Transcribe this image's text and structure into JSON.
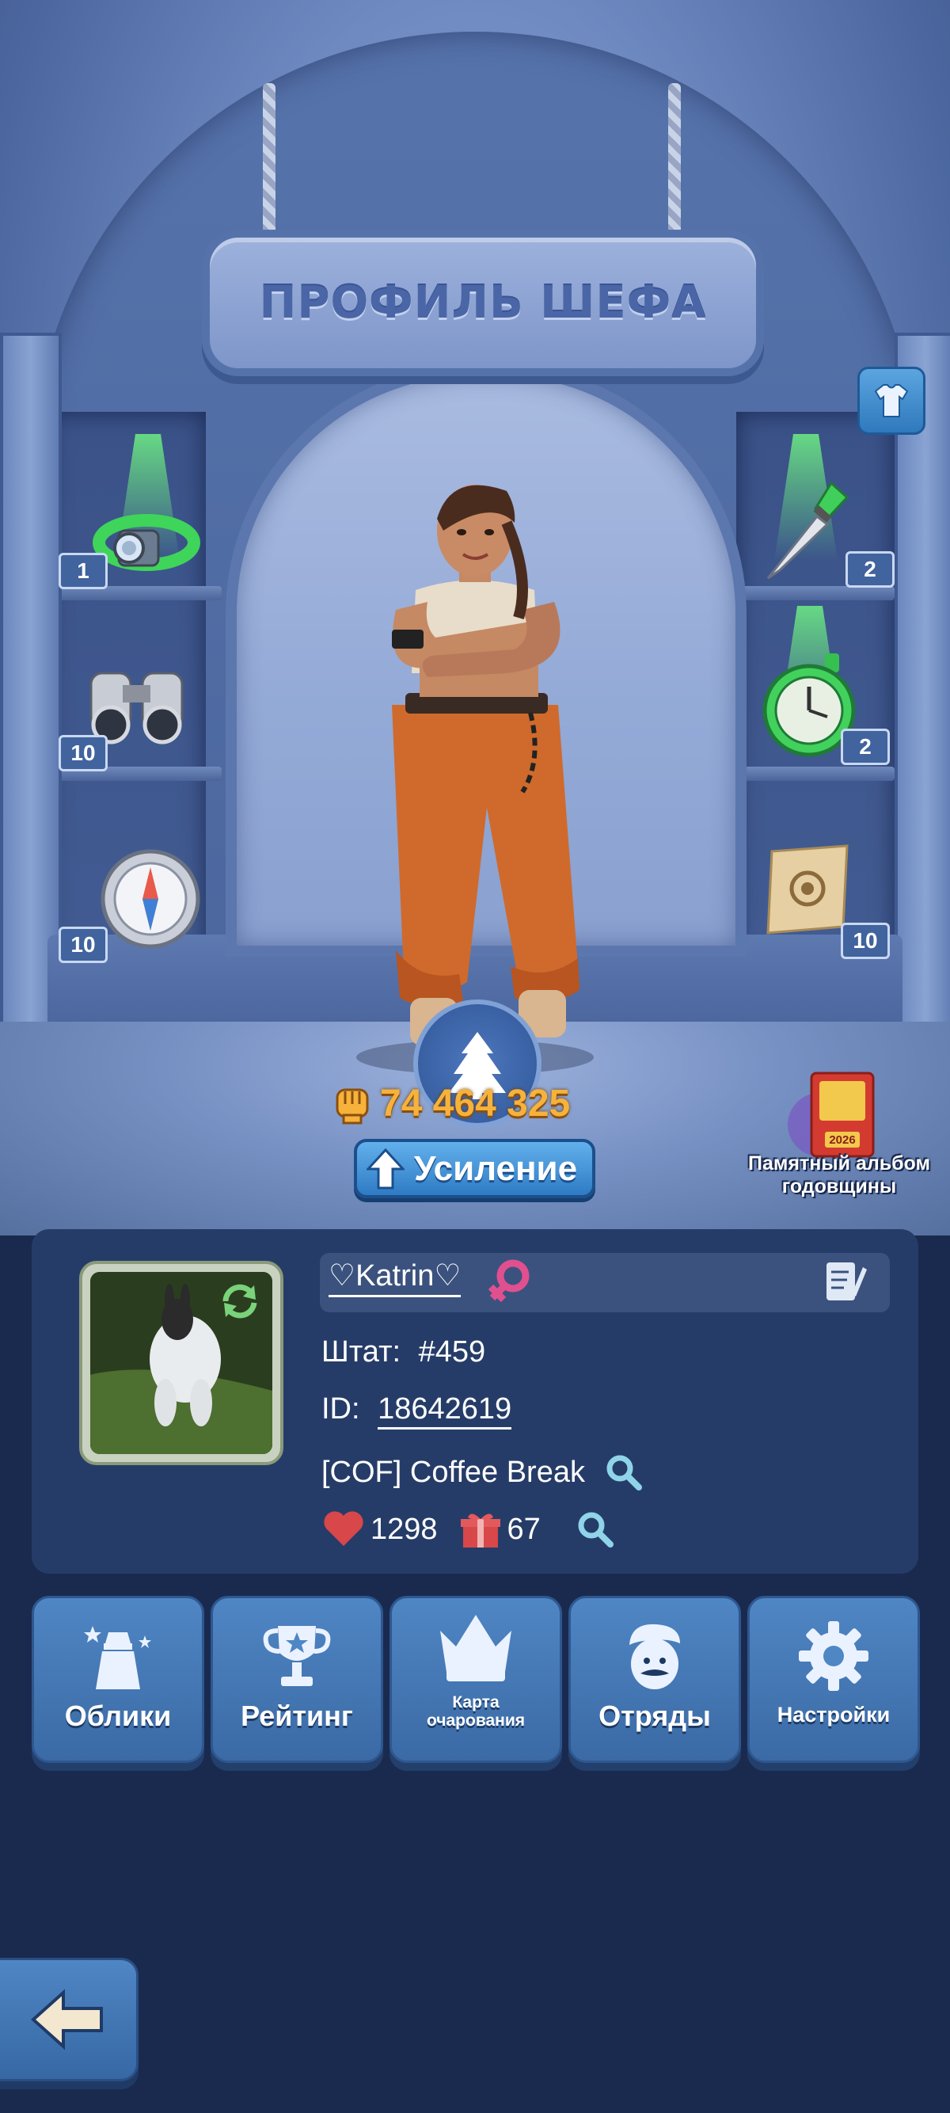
{
  "scene": {
    "title": "ПРОФИЛЬ ШЕФА",
    "wardrobe_icon": "tshirt-icon"
  },
  "shelf_items": {
    "headlamp": {
      "count": "1",
      "icon": "headlamp-icon",
      "highlighted": true
    },
    "binoculars": {
      "count": "10",
      "icon": "binoculars-icon"
    },
    "compass": {
      "count": "10",
      "icon": "compass-icon"
    },
    "knife": {
      "count": "2",
      "icon": "knife-icon",
      "highlighted": true
    },
    "stopwatch": {
      "count": "2",
      "icon": "stopwatch-icon",
      "highlighted": true
    },
    "map": {
      "count": "10",
      "icon": "map-scroll-icon"
    }
  },
  "character": {
    "power": "74 464 325",
    "power_icon": "fist-icon",
    "event_icon": "christmas-tree-icon"
  },
  "boost_button": {
    "label": "Усиление",
    "icon": "arrow-up-icon"
  },
  "anniversary_album": {
    "label_line1": "Памятный альбом",
    "label_line2": "годовщины",
    "year": "2026"
  },
  "profile": {
    "name": "♡Katrin♡",
    "gender_icon": "female-symbol-icon",
    "edit_icon": "edit-note-icon",
    "state_label": "Штат:",
    "state_value": "#459",
    "id_label": "ID:",
    "id_value": "18642619",
    "team": "[COF] Coffee Break",
    "likes": "1298",
    "gifts": "67"
  },
  "buttons": [
    {
      "label": "Облики",
      "icon": "costume-icon"
    },
    {
      "label": "Рейтинг",
      "icon": "trophy-icon"
    },
    {
      "label": "Карта очарования",
      "line1": "Карта",
      "line2": "очарования",
      "icon": "crown-icon"
    },
    {
      "label": "Отряды",
      "icon": "chef-face-icon"
    },
    {
      "label": "Настройки",
      "icon": "gear-icon"
    }
  ],
  "back_button": {
    "icon": "back-arrow-icon"
  },
  "colors": {
    "accent_gold": "#f6b23a",
    "button_blue": "#4f86c4",
    "panel_bg": "#263c68",
    "page_bg": "#1a2a4e"
  }
}
